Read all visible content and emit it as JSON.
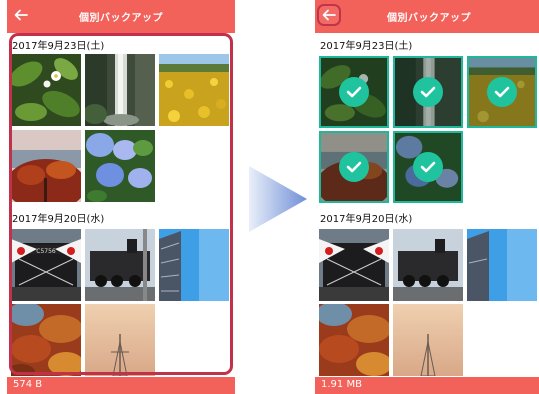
{
  "screens": {
    "before": {
      "title": "個別バックアップ",
      "sections": [
        {
          "date": "2017年9月23日(土)",
          "photos": [
            "white-flower-leaves",
            "waterfall",
            "yellow-flower-field",
            "autumn-tree-red",
            "hydrangea-flowers"
          ],
          "selected": [
            false,
            false,
            false,
            false,
            false
          ]
        },
        {
          "date": "2017年9月20日(水)",
          "photos": [
            "steam-locomotive-flags",
            "locomotive-side",
            "city-building-sky",
            "autumn-leaves",
            "sunset-tower"
          ],
          "selected": [
            false,
            false,
            false,
            false,
            false
          ]
        }
      ],
      "footer_size": "574 B"
    },
    "after": {
      "title": "個別バックアップ",
      "sections": [
        {
          "date": "2017年9月23日(土)",
          "photos": [
            "white-flower-leaves",
            "waterfall",
            "yellow-flower-field",
            "autumn-tree-red",
            "hydrangea-flowers"
          ],
          "selected": [
            true,
            true,
            true,
            true,
            true
          ]
        },
        {
          "date": "2017年9月20日(水)",
          "photos": [
            "steam-locomotive-flags",
            "locomotive-side",
            "city-building-sky",
            "autumn-leaves",
            "sunset-tower"
          ],
          "selected": [
            false,
            false,
            false,
            false,
            false
          ]
        }
      ],
      "footer_size": "1.91 MB"
    }
  },
  "icons": {
    "back": "arrow-left-icon",
    "check": "check-icon",
    "transition": "right-arrow-triangle"
  },
  "colors": {
    "header": "#f2615a",
    "selection": "#1fb89a",
    "highlight_outline": "#c2314a",
    "transition_arrow": "#6f90d8"
  }
}
